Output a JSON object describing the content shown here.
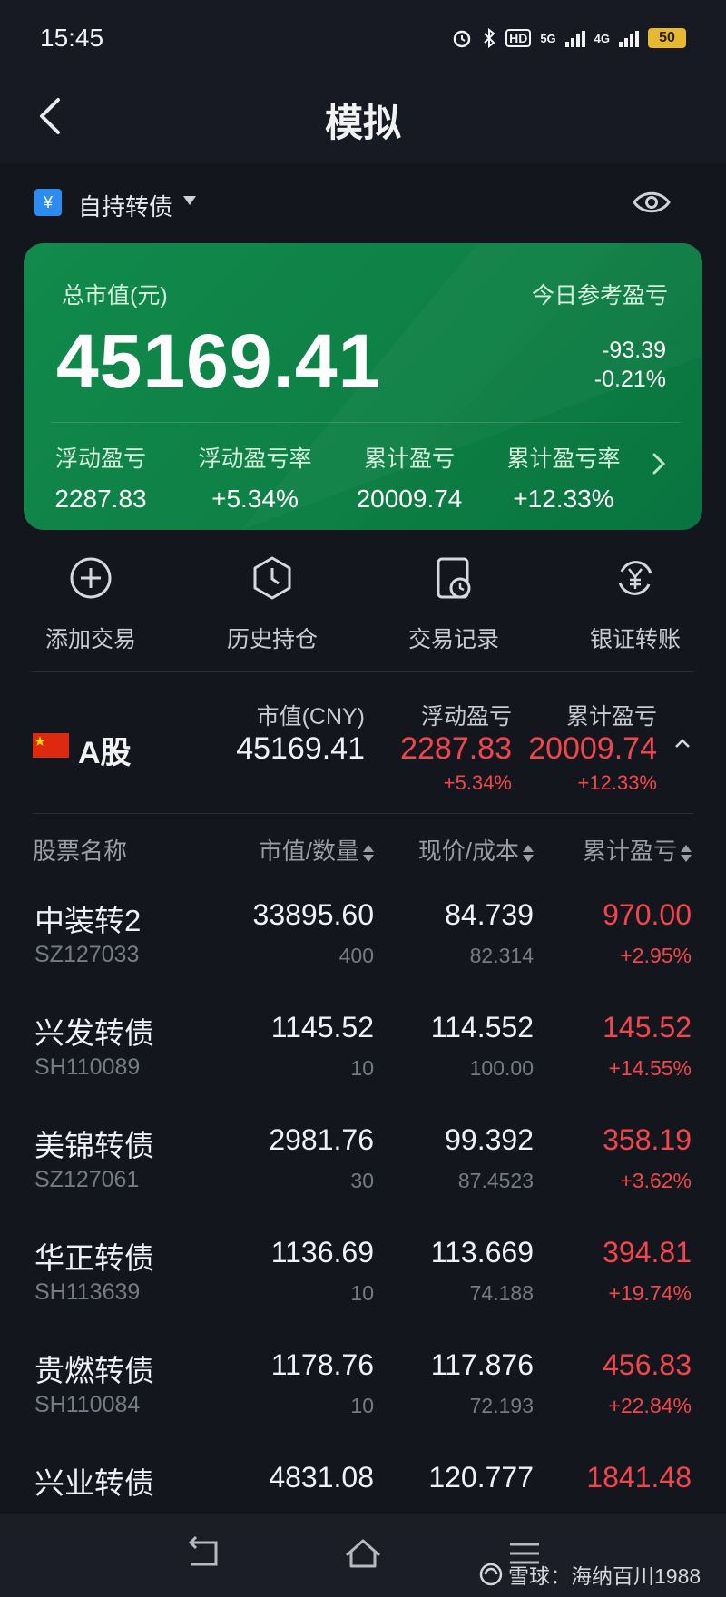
{
  "status_bar": {
    "time": "15:45",
    "network_labels": [
      "HD",
      "5G",
      "4G"
    ],
    "battery": "50"
  },
  "nav": {
    "title": "模拟",
    "back_icon": "chevron-left-icon"
  },
  "account": {
    "label": "自持转债",
    "icon_glyph": "¥",
    "eye_icon": "eye-icon"
  },
  "summary_card": {
    "total_label": "总市值(元)",
    "total_value": "45169.41",
    "today_label": "今日参考盈亏",
    "today_amount": "-93.39",
    "today_pct": "-0.21%",
    "stats": [
      {
        "label": "浮动盈亏",
        "value": "2287.83"
      },
      {
        "label": "浮动盈亏率",
        "value": "+5.34%"
      },
      {
        "label": "累计盈亏",
        "value": "20009.74"
      },
      {
        "label": "累计盈亏率",
        "value": "+12.33%"
      }
    ],
    "card_color": "#0f8447"
  },
  "actions": [
    {
      "label": "添加交易",
      "icon": "plus-circle-icon"
    },
    {
      "label": "历史持仓",
      "icon": "clock-hexagon-icon"
    },
    {
      "label": "交易记录",
      "icon": "document-clock-icon"
    },
    {
      "label": "银证转账",
      "icon": "transfer-yuan-icon"
    }
  ],
  "market": {
    "label": "A股",
    "flag": "china-flag-icon",
    "headers": {
      "market_value": "市值(CNY)",
      "float_pl": "浮动盈亏",
      "cum_pl": "累计盈亏"
    },
    "market_value": "45169.41",
    "float_pl": "2287.83",
    "float_pl_pct": "+5.34%",
    "cum_pl": "20009.74",
    "cum_pl_pct": "+12.33%"
  },
  "table": {
    "headers": {
      "name": "股票名称",
      "mv_qty": "市值/数量",
      "price_cost": "现价/成本",
      "cum_pl": "累计盈亏"
    },
    "rows": [
      {
        "name": "中装转2",
        "code": "SZ127033",
        "market_value": "33895.60",
        "quantity": "400",
        "price": "84.739",
        "cost": "82.314",
        "pl": "970.00",
        "pl_pct": "+2.95%"
      },
      {
        "name": "兴发转债",
        "code": "SH110089",
        "market_value": "1145.52",
        "quantity": "10",
        "price": "114.552",
        "cost": "100.00",
        "pl": "145.52",
        "pl_pct": "+14.55%"
      },
      {
        "name": "美锦转债",
        "code": "SZ127061",
        "market_value": "2981.76",
        "quantity": "30",
        "price": "99.392",
        "cost": "87.4523",
        "pl": "358.19",
        "pl_pct": "+3.62%"
      },
      {
        "name": "华正转债",
        "code": "SH113639",
        "market_value": "1136.69",
        "quantity": "10",
        "price": "113.669",
        "cost": "74.188",
        "pl": "394.81",
        "pl_pct": "+19.74%"
      },
      {
        "name": "贵燃转债",
        "code": "SH110084",
        "market_value": "1178.76",
        "quantity": "10",
        "price": "117.876",
        "cost": "72.193",
        "pl": "456.83",
        "pl_pct": "+22.84%"
      },
      {
        "name": "兴业转债",
        "code": "",
        "market_value": "4831.08",
        "quantity": "",
        "price": "120.777",
        "cost": "",
        "pl": "1841.48",
        "pl_pct": ""
      }
    ]
  },
  "colors": {
    "positive": "#f4454c",
    "background": "#14161d",
    "text": "#f0f1f5",
    "muted": "#767a86"
  },
  "bottom_nav": {
    "icons": [
      "back-gesture-icon",
      "home-icon",
      "menu-icon"
    ]
  },
  "watermark": {
    "text": "雪球：海纳百川1988"
  }
}
